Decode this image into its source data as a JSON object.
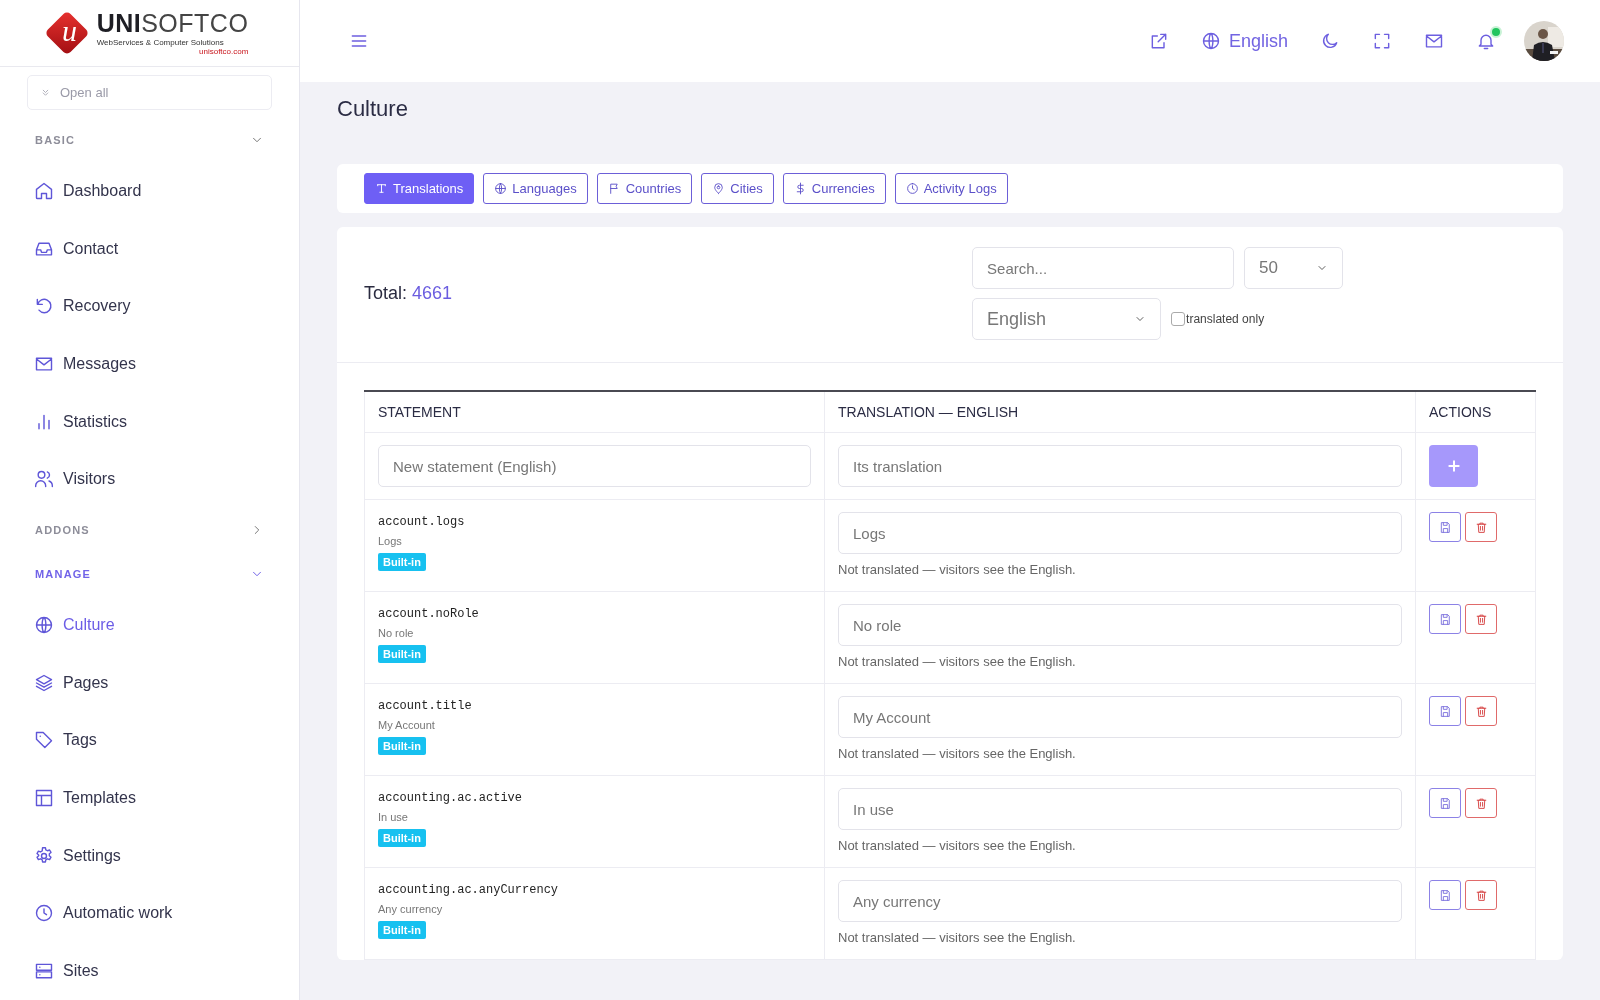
{
  "logo": {
    "mark": "u",
    "brand_bold": "UNI",
    "brand_light": "SOFTCO",
    "tagline": "WebServices & Computer Solutions",
    "url": "unisoftco.com"
  },
  "sidebar": {
    "open_all": "Open all",
    "sections": [
      {
        "title": "BASIC",
        "expanded": true,
        "active": false,
        "items": [
          {
            "label": "Dashboard",
            "selected": false
          },
          {
            "label": "Contact",
            "selected": false
          },
          {
            "label": "Recovery",
            "selected": false
          },
          {
            "label": "Messages",
            "selected": false
          },
          {
            "label": "Statistics",
            "selected": false
          },
          {
            "label": "Visitors",
            "selected": false
          }
        ]
      },
      {
        "title": "ADDONS",
        "expanded": false,
        "active": false
      },
      {
        "title": "MANAGE",
        "expanded": true,
        "active": true,
        "items": [
          {
            "label": "Culture",
            "selected": true
          },
          {
            "label": "Pages",
            "selected": false
          },
          {
            "label": "Tags",
            "selected": false
          },
          {
            "label": "Templates",
            "selected": false
          },
          {
            "label": "Settings",
            "selected": false
          },
          {
            "label": "Automatic work",
            "selected": false
          },
          {
            "label": "Sites",
            "selected": false
          }
        ]
      }
    ]
  },
  "header": {
    "language": "English",
    "unread_notifications": true
  },
  "page_title": "Culture",
  "tabs": [
    {
      "label": "Translations",
      "selected": true
    },
    {
      "label": "Languages",
      "selected": false
    },
    {
      "label": "Countries",
      "selected": false
    },
    {
      "label": "Cities",
      "selected": false
    },
    {
      "label": "Currencies",
      "selected": false
    },
    {
      "label": "Activity Logs",
      "selected": false
    }
  ],
  "total": {
    "label": "Total:",
    "value": "4661"
  },
  "filters": {
    "search_placeholder": "Search...",
    "per_page": "50",
    "language": "English",
    "translated_only": {
      "label": "translated only",
      "checked": false
    }
  },
  "table": {
    "columns": [
      "STATEMENT",
      "TRANSLATION — ENGLISH",
      "ACTIONS"
    ],
    "new_row": {
      "statement_placeholder": "New statement (English)",
      "translation_placeholder": "Its translation",
      "add_disabled": true
    },
    "rows": [
      {
        "key": "account.logs",
        "default": "Logs",
        "badge": "Built-in",
        "translation_placeholder": "Logs",
        "note": "Not translated — visitors see the English."
      },
      {
        "key": "account.noRole",
        "default": "No role",
        "badge": "Built-in",
        "translation_placeholder": "No role",
        "note": "Not translated — visitors see the English."
      },
      {
        "key": "account.title",
        "default": "My Account",
        "badge": "Built-in",
        "translation_placeholder": "My Account",
        "note": "Not translated — visitors see the English."
      },
      {
        "key": "accounting.ac.active",
        "default": "In use",
        "badge": "Built-in",
        "translation_placeholder": "In use",
        "note": "Not translated — visitors see the English."
      },
      {
        "key": "accounting.ac.anyCurrency",
        "default": "Any currency",
        "badge": "Built-in",
        "translation_placeholder": "Any currency",
        "note": "Not translated — visitors see the English."
      }
    ]
  }
}
